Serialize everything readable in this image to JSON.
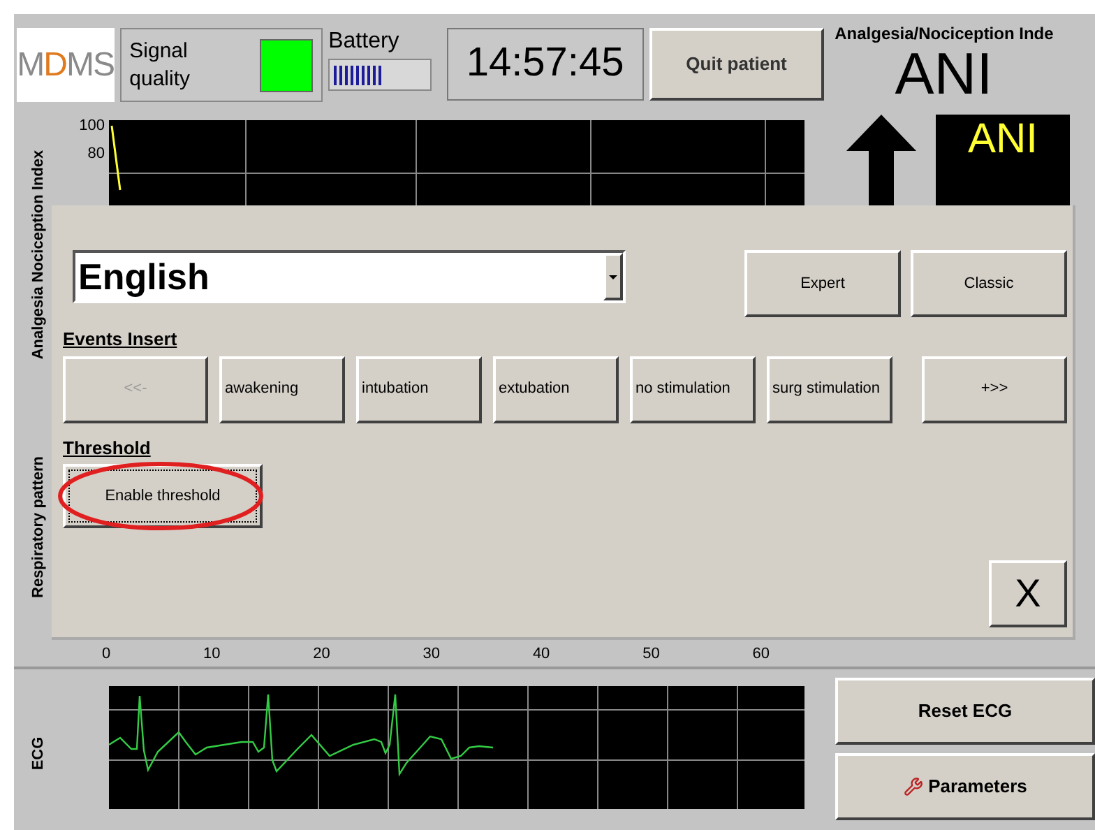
{
  "header": {
    "logo": [
      {
        "text": "M",
        "accent": false
      },
      {
        "text": "D",
        "accent": true
      },
      {
        "text": "MS",
        "accent": false
      }
    ],
    "signal_quality": {
      "label": "Signal quality"
    },
    "battery": {
      "label": "Battery"
    },
    "clock": "14:57:45",
    "quit_button": "Quit patient",
    "ani": {
      "title": "Analgesia/Nociception Inde",
      "name": "ANI"
    }
  },
  "trend": {
    "ylabel": "Analgesia Nociception Index",
    "y_ticks": [
      "100",
      "80"
    ],
    "x_ticks": [
      "0",
      "10",
      "20",
      "30",
      "40",
      "50",
      "60"
    ],
    "lower_label": "Respiratory pattern"
  },
  "ani_box": {
    "label": "ANI"
  },
  "dialog": {
    "language": "English",
    "mode_buttons": [
      "Expert",
      "Classic"
    ],
    "events_title": "Events Insert",
    "events": [
      {
        "label": "<<-",
        "disabled": true
      },
      {
        "label": "awakening",
        "disabled": false
      },
      {
        "label": "intubation",
        "disabled": false
      },
      {
        "label": "extubation",
        "disabled": false
      },
      {
        "label": "no stimulation",
        "disabled": false
      },
      {
        "label": "surg stimulation",
        "disabled": false
      },
      {
        "label": "+>>",
        "disabled": false
      }
    ],
    "threshold_title": "Threshold",
    "threshold_button": "Enable threshold",
    "close": "X"
  },
  "ecg": {
    "label": "ECG",
    "buttons": [
      "Reset ECG",
      "Parameters"
    ]
  }
}
